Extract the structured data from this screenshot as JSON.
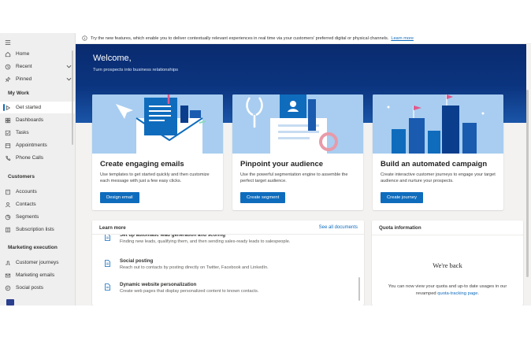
{
  "banner": {
    "text": "Try the new features, which enable you to deliver contextually relevant experiences in real time via your customers' preferred digital or physical channels.",
    "link": "Learn more"
  },
  "sidebar": {
    "home": "Home",
    "recent": "Recent",
    "pinned": "Pinned",
    "my_work_header": "My Work",
    "my_work": [
      "Get started",
      "Dashboards",
      "Tasks",
      "Appointments",
      "Phone Calls"
    ],
    "customers_header": "Customers",
    "customers": [
      "Accounts",
      "Contacts",
      "Segments",
      "Subscription lists"
    ],
    "marketing_header": "Marketing execution",
    "marketing": [
      "Customer journeys",
      "Marketing emails",
      "Social posts"
    ]
  },
  "hero": {
    "title": "Welcome,",
    "subtitle": "Turn prospects into business relationships"
  },
  "cards": [
    {
      "title": "Create engaging emails",
      "description": "Use templates to get started quickly and then customize each message with just a few easy clicks.",
      "button": "Design email"
    },
    {
      "title": "Pinpoint your audience",
      "description": "Use the powerful segmentation engine to assemble the perfect target audience.",
      "button": "Create segment"
    },
    {
      "title": "Build an automated campaign",
      "description": "Create interactive customer journeys to engage your target audience and nurture your prospects.",
      "button": "Create journey"
    }
  ],
  "learn_more": {
    "title": "Learn more",
    "see_all": "See all documents",
    "items": [
      {
        "title": "Set up automatic lead generation and scoring",
        "description": "Finding new leads, qualifying them, and then sending sales-ready leads to salespeople."
      },
      {
        "title": "Social posting",
        "description": "Reach out to contacts by posting directly on Twitter, Facebook and LinkedIn."
      },
      {
        "title": "Dynamic website personalization",
        "description": "Create web pages that display personalized content to known contacts."
      }
    ]
  },
  "quota": {
    "title": "Quota information",
    "headline": "We're back",
    "message": "You can now view your quota and up-to date usages in our revamped",
    "link": "quota-tracking page",
    "period": "."
  },
  "colors": {
    "accent": "#0f6cbd",
    "hero_dark": "#0a2a6e",
    "card_art": "#a8cdf0"
  }
}
